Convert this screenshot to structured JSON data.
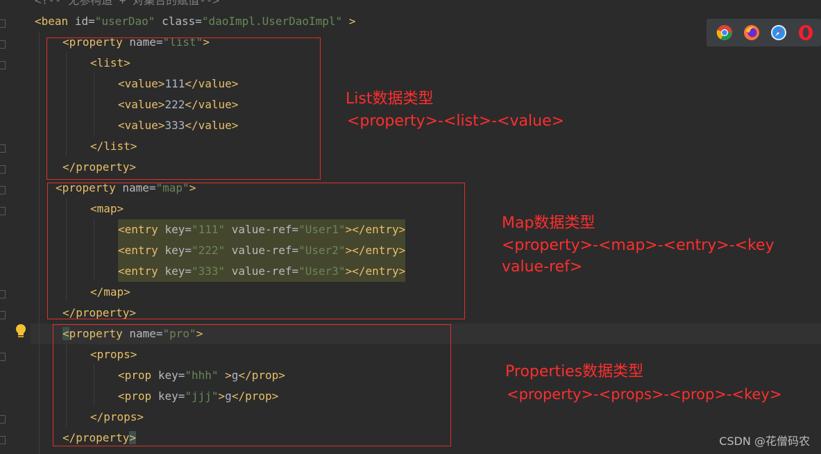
{
  "editor": {
    "comment_line": "<!-- 无参构造 + 对集合的赋值-->",
    "bean": {
      "tag": "<bean",
      "id_attr": "id",
      "id_val": "\"userDao\"",
      "class_attr": "class",
      "class_val": "\"daoImpl.UserDaoImpl\"",
      "end": " >"
    },
    "list_block": {
      "prop_open": "<property",
      "name_attr": "name",
      "name_val": "\"list\"",
      "prop_close": ">",
      "list_open": "<list>",
      "values": [
        "111",
        "222",
        "333"
      ],
      "value_open": "<value>",
      "value_close": "</value>",
      "list_close": "</list>",
      "prop_end": "</property>"
    },
    "map_block": {
      "prop_open": "<property",
      "name_attr": "name",
      "name_val": "\"map\"",
      "prop_close": ">",
      "map_open": "<map>",
      "entries": [
        {
          "key": "\"111\"",
          "ref": "\"User1\""
        },
        {
          "key": "\"222\"",
          "ref": "\"User2\""
        },
        {
          "key": "\"333\"",
          "ref": "\"User3\""
        }
      ],
      "entry_open": "<entry",
      "key_attr": "key",
      "ref_attr": "value-ref",
      "entry_end": "></entry>",
      "map_close": "</map>",
      "prop_end": "</property>"
    },
    "props_block": {
      "prop_open_lt": "<",
      "prop_open_word": "property",
      "name_attr": "name",
      "name_val": "\"pro\"",
      "prop_close": ">",
      "props_open": "<props>",
      "items": [
        {
          "key": "\"hhh\"",
          "sep": " >",
          "val": "g"
        },
        {
          "key": "\"jjj\"",
          "sep": ">",
          "val": "g"
        }
      ],
      "prop_tag": "<prop",
      "key_attr": "key",
      "prop_item_close": "</prop>",
      "props_close": "</props>",
      "prop_end_text": "</property",
      "prop_end_gt": ">"
    }
  },
  "annotations": {
    "list_title": "List数据类型",
    "list_path": "<property>-<list>-<value>",
    "map_title": "Map数据类型",
    "map_path1": "<property>-<map>-<entry>-<key",
    "map_path2": "value-ref>",
    "props_title": "Properties数据类型",
    "props_path": "<property>-<props>-<prop>-<key>"
  },
  "browser_icons": [
    "chrome-icon",
    "firefox-icon",
    "safari-icon",
    "opera-icon"
  ],
  "watermark": "CSDN @花僧码农",
  "colors": {
    "annotation": "#ff2e2e",
    "tag": "#e8bf6a",
    "string": "#6a8759",
    "attr": "#bababa"
  }
}
